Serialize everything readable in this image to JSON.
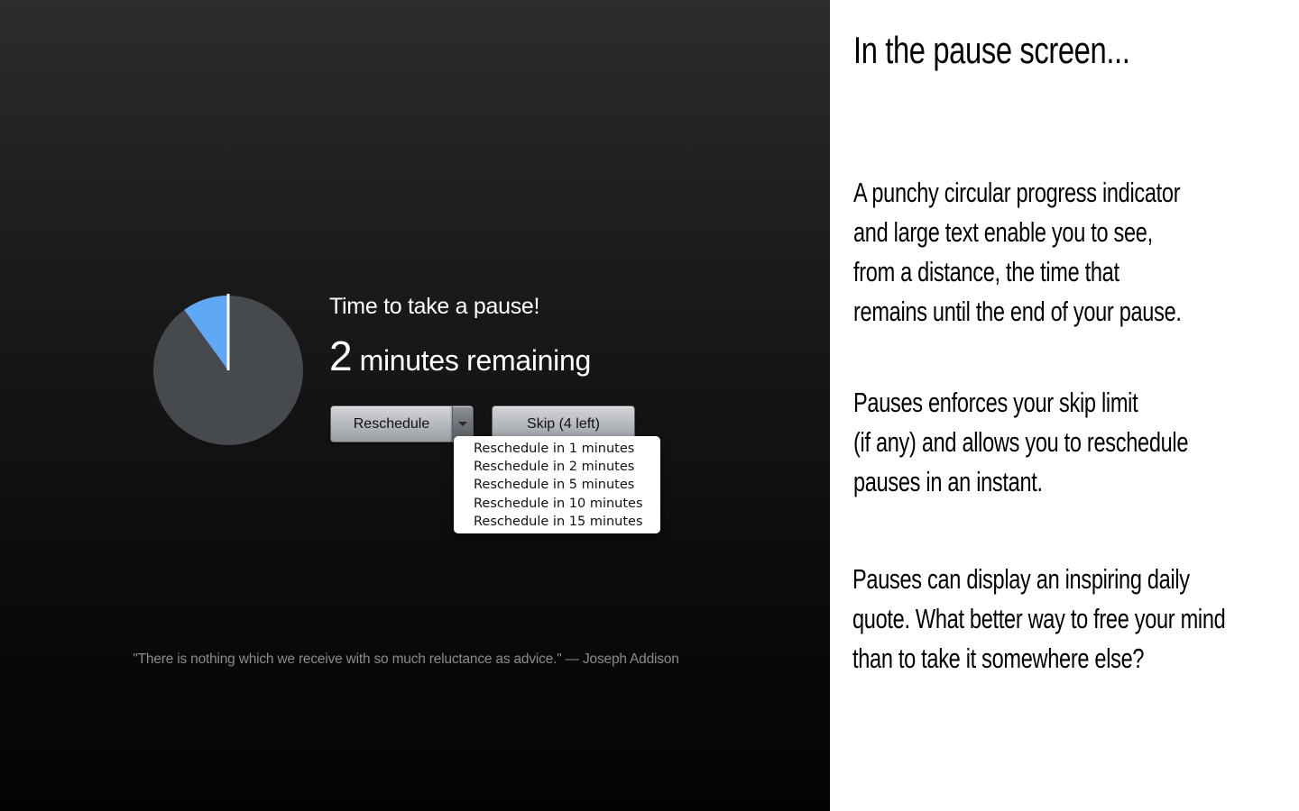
{
  "pause_screen": {
    "progress_fraction": 0.1,
    "colors": {
      "pie_background": "#46494e",
      "pie_elapsed": "#5fa8f5",
      "pie_hand": "#ffffff"
    },
    "title": "Time to take a pause!",
    "remaining_number": "2",
    "remaining_unit": "minutes remaining",
    "reschedule_label": "Reschedule",
    "dropdown_icon": "chevron-down-icon",
    "skip_label": "Skip (4 left)",
    "reschedule_menu": [
      "Reschedule in 1 minutes",
      "Reschedule in 2 minutes",
      "Reschedule in 5 minutes",
      "Reschedule in 10 minutes",
      "Reschedule in 15 minutes"
    ],
    "quote": "\"There is nothing which we receive with so much reluctance as advice.\" — Joseph Addison"
  },
  "description": {
    "title": "In the pause screen...",
    "paragraphs": [
      [
        "A punchy circular progress indicator",
        "and large text enable you to see,",
        "from a distance, the time that",
        "remains until the end of your pause."
      ],
      [
        "Pauses enforces your skip limit",
        "(if any) and allows you to reschedule",
        "pauses in an instant."
      ],
      [
        "Pauses can display an inspiring daily",
        "quote. What better way to free your mind",
        "than to take it somewhere else?"
      ]
    ]
  }
}
